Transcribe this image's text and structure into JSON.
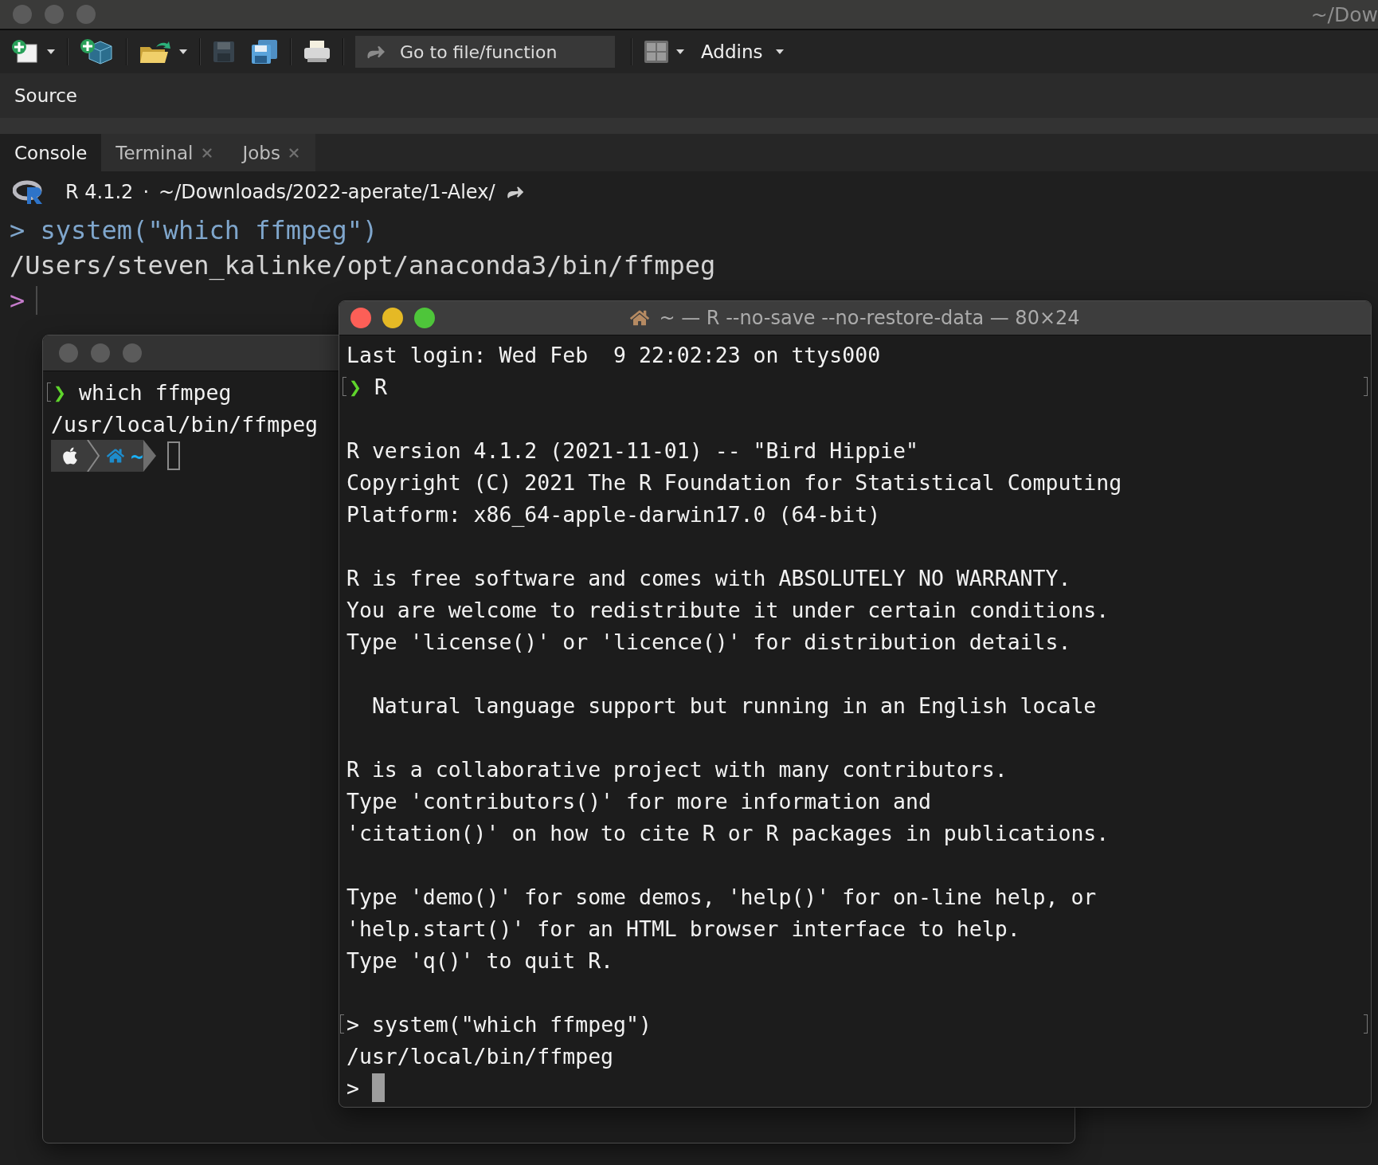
{
  "window": {
    "title": "~/Dow"
  },
  "toolbar": {
    "groups": [
      [
        {
          "kind": "new-file",
          "menu": true,
          "disabled": false
        }
      ],
      [
        {
          "kind": "new-project",
          "menu": false,
          "disabled": false
        }
      ],
      [
        {
          "kind": "open",
          "menu": true,
          "disabled": false
        }
      ],
      [
        {
          "kind": "save",
          "menu": false,
          "disabled": true
        },
        {
          "kind": "save-all",
          "menu": false,
          "disabled": false
        }
      ],
      [
        {
          "kind": "print",
          "menu": false,
          "disabled": false
        }
      ]
    ],
    "search": {
      "placeholder": "Go to file/function"
    },
    "addins": {
      "label": "Addins"
    }
  },
  "source_pane": {
    "title": "Source"
  },
  "console_pane": {
    "tabs": [
      {
        "label": "Console",
        "selected": true,
        "closable": false
      },
      {
        "label": "Terminal",
        "selected": false,
        "closable": true
      },
      {
        "label": "Jobs",
        "selected": false,
        "closable": true
      }
    ],
    "version": "R 4.1.2",
    "separator": "·",
    "path": "~/Downloads/2022-aperate/1-Alex/",
    "lines": [
      {
        "kind": "input",
        "prompt": ">",
        "text": "system(\"which ffmpeg\")"
      },
      {
        "kind": "output",
        "text": "/Users/steven_kalinke/opt/anaconda3/bin/ffmpeg"
      },
      {
        "kind": "cursor",
        "prompt": ">"
      }
    ]
  },
  "back_terminal": {
    "lines": [
      {
        "kind": "shell",
        "prompt": "❯",
        "text": "which ffmpeg",
        "marked": true
      },
      {
        "kind": "text",
        "text": "/usr/local/bin/ffmpeg",
        "marked": false
      },
      {
        "kind": "powerline",
        "text": "~",
        "marked": false
      }
    ]
  },
  "front_terminal": {
    "title": "~ — R --no-save --no-restore-data — 80×24",
    "lines": [
      {
        "kind": "text",
        "text": "Last login: Wed Feb  9 22:02:23 on ttys000",
        "marked": false
      },
      {
        "kind": "shell",
        "prompt": "❯",
        "text": "R",
        "marked": true
      },
      {
        "kind": "blank"
      },
      {
        "kind": "text",
        "text": "R version 4.1.2 (2021-11-01) -- \"Bird Hippie\"",
        "marked": false
      },
      {
        "kind": "text",
        "text": "Copyright (C) 2021 The R Foundation for Statistical Computing",
        "marked": false
      },
      {
        "kind": "text",
        "text": "Platform: x86_64-apple-darwin17.0 (64-bit)",
        "marked": false
      },
      {
        "kind": "blank"
      },
      {
        "kind": "text",
        "text": "R is free software and comes with ABSOLUTELY NO WARRANTY.",
        "marked": false
      },
      {
        "kind": "text",
        "text": "You are welcome to redistribute it under certain conditions.",
        "marked": false
      },
      {
        "kind": "text",
        "text": "Type 'license()' or 'licence()' for distribution details.",
        "marked": false
      },
      {
        "kind": "blank"
      },
      {
        "kind": "text",
        "text": "  Natural language support but running in an English locale",
        "marked": false
      },
      {
        "kind": "blank"
      },
      {
        "kind": "text",
        "text": "R is a collaborative project with many contributors.",
        "marked": false
      },
      {
        "kind": "text",
        "text": "Type 'contributors()' for more information and",
        "marked": false
      },
      {
        "kind": "text",
        "text": "'citation()' on how to cite R or R packages in publications.",
        "marked": false
      },
      {
        "kind": "blank"
      },
      {
        "kind": "text",
        "text": "Type 'demo()' for some demos, 'help()' for on-line help, or",
        "marked": false
      },
      {
        "kind": "text",
        "text": "'help.start()' for an HTML browser interface to help.",
        "marked": false
      },
      {
        "kind": "text",
        "text": "Type 'q()' to quit R.",
        "marked": false
      },
      {
        "kind": "blank"
      },
      {
        "kind": "rinput",
        "prompt": ">",
        "text": "system(\"which ffmpeg\")",
        "marked": true
      },
      {
        "kind": "text",
        "text": "/usr/local/bin/ffmpeg",
        "marked": false
      },
      {
        "kind": "cursor",
        "prompt": ">",
        "marked": false
      }
    ]
  }
}
